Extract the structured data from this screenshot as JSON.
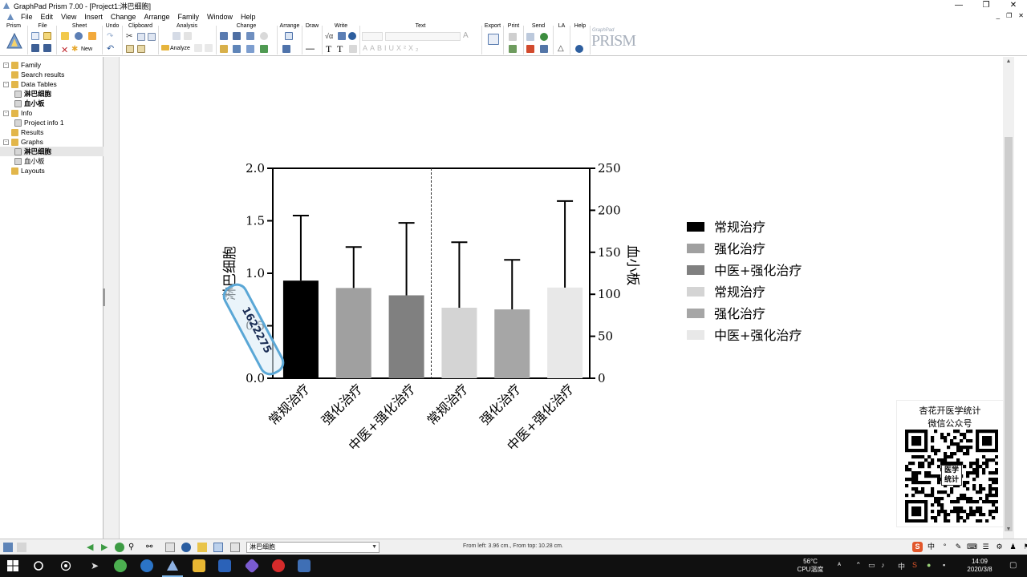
{
  "window": {
    "title": "GraphPad Prism 7.00 - [Project1:淋巴细胞]",
    "controls": [
      "—",
      "❐",
      "✕"
    ],
    "mdi_controls": [
      "_",
      "❐",
      "✕"
    ]
  },
  "menu": [
    "File",
    "Edit",
    "View",
    "Insert",
    "Change",
    "Arrange",
    "Family",
    "Window",
    "Help"
  ],
  "toolbar": {
    "groups": [
      "Prism",
      "File",
      "Sheet",
      "Undo",
      "Clipboard",
      "Analysis",
      "Change",
      "Arrange",
      "Draw",
      "Write",
      "Text",
      "Export",
      "Print",
      "Send",
      "LA",
      "Help"
    ],
    "new_label": "New",
    "analyze_label": "Analyze",
    "brand": "PRISM",
    "brand_small": "GraphPad"
  },
  "navigator": {
    "items": [
      {
        "label": "Family",
        "level": 0,
        "expander": "-"
      },
      {
        "label": "Search results",
        "level": 0
      },
      {
        "label": "Data Tables",
        "level": 0,
        "expander": "-"
      },
      {
        "label": "淋巴细胞",
        "level": 1,
        "bold": true
      },
      {
        "label": "血小板",
        "level": 1,
        "bold": true
      },
      {
        "label": "Info",
        "level": 0,
        "expander": "-"
      },
      {
        "label": "Project info 1",
        "level": 1
      },
      {
        "label": "Results",
        "level": 0
      },
      {
        "label": "Graphs",
        "level": 0,
        "expander": "-"
      },
      {
        "label": "淋巴细胞",
        "level": 1,
        "bold": true,
        "selected": true
      },
      {
        "label": "血小板",
        "level": 1
      },
      {
        "label": "Layouts",
        "level": 0
      }
    ]
  },
  "chart_data": {
    "type": "bar",
    "left_axis": {
      "label": "淋巴细胞",
      "ticks": [
        "0.0",
        "0.5",
        "1.0",
        "1.5",
        "2.0"
      ],
      "ylim": [
        0,
        2
      ]
    },
    "right_axis": {
      "label": "血小板",
      "ticks": [
        "0",
        "50",
        "100",
        "150",
        "200",
        "250"
      ],
      "ylim": [
        0,
        250
      ]
    },
    "categories": [
      "常规治疗",
      "强化治疗",
      "中医+强化治疗",
      "常规治疗",
      "强化治疗",
      "中医+强化治疗"
    ],
    "groups": [
      {
        "axis": "left",
        "means": [
          0.93,
          0.86,
          0.79
        ],
        "error_tops": [
          1.55,
          1.25,
          1.48
        ],
        "colors": [
          "#000000",
          "#a0a0a0",
          "#808080"
        ]
      },
      {
        "axis": "right",
        "means": [
          84,
          82,
          108
        ],
        "error_tops": [
          162,
          141,
          211
        ],
        "colors": [
          "#d4d4d4",
          "#a6a6a6",
          "#e8e8e8"
        ]
      }
    ],
    "legend": [
      {
        "label": "常规治疗",
        "color": "#000000"
      },
      {
        "label": "强化治疗",
        "color": "#a0a0a0"
      },
      {
        "label": "中医+强化治疗",
        "color": "#808080"
      },
      {
        "label": "常规治疗",
        "color": "#d4d4d4"
      },
      {
        "label": "强化治疗",
        "color": "#a6a6a6"
      },
      {
        "label": "中医+强化治疗",
        "color": "#e8e8e8"
      }
    ],
    "legend_position": "right",
    "separator": "dashed line between the two axis groups"
  },
  "overlay": {
    "stamp_text": "1622275"
  },
  "wx": {
    "line1": "杏花开医学统计",
    "line2": "微信公众号",
    "badge_line1": "医学",
    "badge_line2": "统计"
  },
  "statusbar": {
    "sheet_value": "淋巴细胞",
    "coords": "From left: 3.96 cm., From top: 10.28 cm.",
    "ime": [
      "S",
      "中",
      "°",
      "✎",
      "⌨",
      "☰",
      "⚙",
      "♟",
      "⚑"
    ]
  },
  "taskbar": {
    "weather_temp": "56°C",
    "weather_label": "CPU温度",
    "time": "14:09",
    "date": "2020/3/8",
    "ime_lang": "中"
  }
}
